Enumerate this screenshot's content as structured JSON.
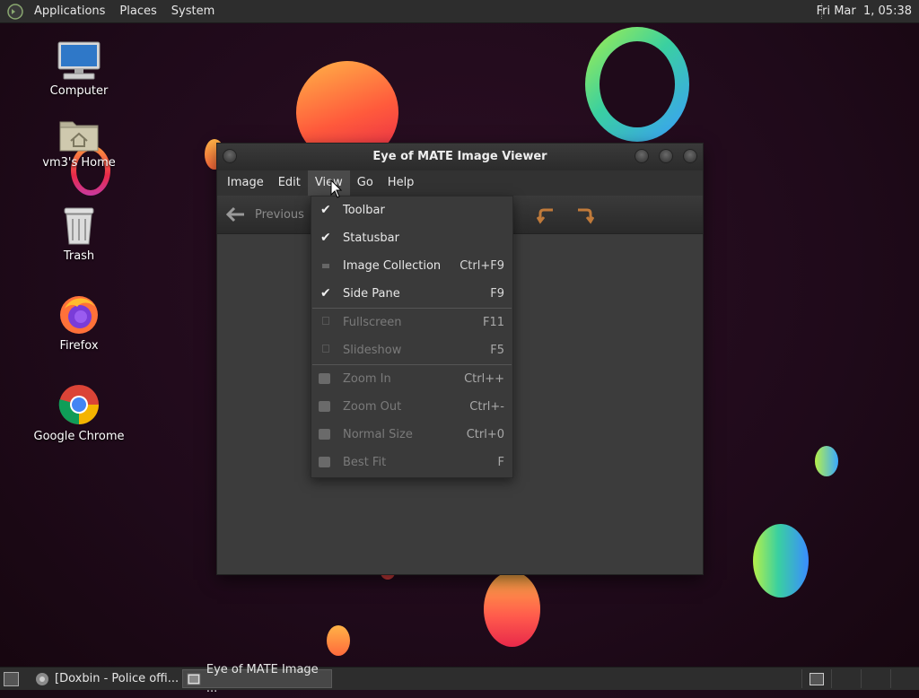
{
  "top_panel": {
    "menus": [
      "Applications",
      "Places",
      "System"
    ],
    "clock": "Fri Mar  1, 05:38"
  },
  "desktop_icons": [
    {
      "label": "Computer",
      "icon": "computer-icon"
    },
    {
      "label": "vm3's Home",
      "icon": "home-folder-icon"
    },
    {
      "label": "Trash",
      "icon": "trash-icon"
    },
    {
      "label": "Firefox",
      "icon": "firefox-icon"
    },
    {
      "label": "Google Chrome",
      "icon": "chrome-icon"
    }
  ],
  "window": {
    "title": "Eye of MATE Image Viewer",
    "menus": [
      "Image",
      "Edit",
      "View",
      "Go",
      "Help"
    ],
    "active_menu": "View",
    "toolbar": {
      "previous_label": "Previous"
    }
  },
  "view_menu": {
    "items": [
      {
        "label": "Toolbar",
        "accel": "",
        "checked": true,
        "enabled": true
      },
      {
        "label": "Statusbar",
        "accel": "",
        "checked": true,
        "enabled": true
      },
      {
        "label": "Image Collection",
        "accel": "Ctrl+F9",
        "checked": false,
        "enabled": true
      },
      {
        "label": "Side Pane",
        "accel": "F9",
        "checked": true,
        "enabled": true
      },
      {
        "label": "Fullscreen",
        "accel": "F11",
        "checked": false,
        "enabled": false
      },
      {
        "label": "Slideshow",
        "accel": "F5",
        "checked": false,
        "enabled": false
      },
      {
        "label": "Zoom In",
        "accel": "Ctrl++",
        "checked": false,
        "enabled": false
      },
      {
        "label": "Zoom Out",
        "accel": "Ctrl+-",
        "checked": false,
        "enabled": false
      },
      {
        "label": "Normal Size",
        "accel": "Ctrl+0",
        "checked": false,
        "enabled": false
      },
      {
        "label": "Best Fit",
        "accel": "F",
        "checked": false,
        "enabled": false
      }
    ]
  },
  "taskbar": {
    "tasks": [
      {
        "label": "[Doxbin - Police offi...",
        "icon": "chrome-icon",
        "active": false
      },
      {
        "label": "Eye of MATE Image ...",
        "icon": "image-viewer-icon",
        "active": true
      }
    ]
  },
  "colors": {
    "background": "#1f0a1a",
    "panel": "#2d2d2d",
    "window": "#3b3b3b",
    "menu_disabled_text": "#7a7a7a"
  }
}
